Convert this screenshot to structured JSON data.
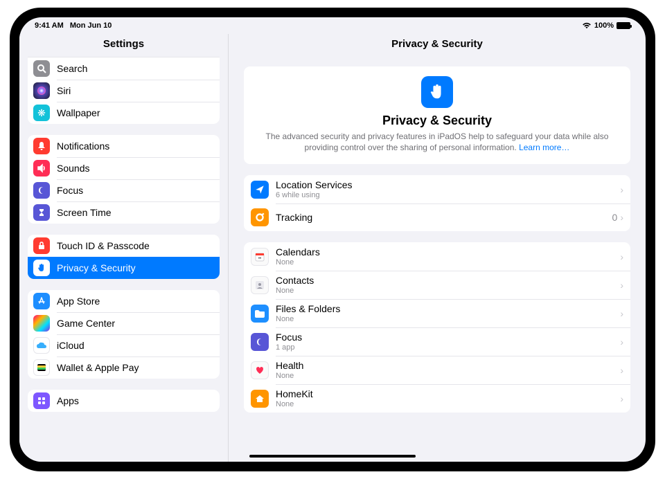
{
  "statusbar": {
    "time": "9:41 AM",
    "date": "Mon Jun 10",
    "battery": "100%"
  },
  "sidebar": {
    "title": "Settings",
    "groups": [
      {
        "id": "g0",
        "items": [
          {
            "label": "Search"
          },
          {
            "label": "Siri"
          },
          {
            "label": "Wallpaper"
          }
        ]
      },
      {
        "id": "g1",
        "items": [
          {
            "label": "Notifications"
          },
          {
            "label": "Sounds"
          },
          {
            "label": "Focus"
          },
          {
            "label": "Screen Time"
          }
        ]
      },
      {
        "id": "g2",
        "items": [
          {
            "label": "Touch ID & Passcode"
          },
          {
            "label": "Privacy & Security",
            "selected": true
          }
        ]
      },
      {
        "id": "g3",
        "items": [
          {
            "label": "App Store"
          },
          {
            "label": "Game Center"
          },
          {
            "label": "iCloud"
          },
          {
            "label": "Wallet & Apple Pay"
          }
        ]
      },
      {
        "id": "g4",
        "items": [
          {
            "label": "Apps"
          }
        ]
      }
    ]
  },
  "main": {
    "title": "Privacy & Security",
    "hero": {
      "title": "Privacy & Security",
      "desc": "The advanced security and privacy features in iPadOS help to safeguard your data while also providing control over the sharing of personal information.",
      "link": "Learn more…"
    },
    "section1": [
      {
        "label": "Location Services",
        "sub": "6 while using"
      },
      {
        "label": "Tracking",
        "value": "0"
      }
    ],
    "section2": [
      {
        "label": "Calendars",
        "sub": "None"
      },
      {
        "label": "Contacts",
        "sub": "None"
      },
      {
        "label": "Files & Folders",
        "sub": "None"
      },
      {
        "label": "Focus",
        "sub": "1 app"
      },
      {
        "label": "Health",
        "sub": "None"
      },
      {
        "label": "HomeKit",
        "sub": "None"
      }
    ]
  }
}
